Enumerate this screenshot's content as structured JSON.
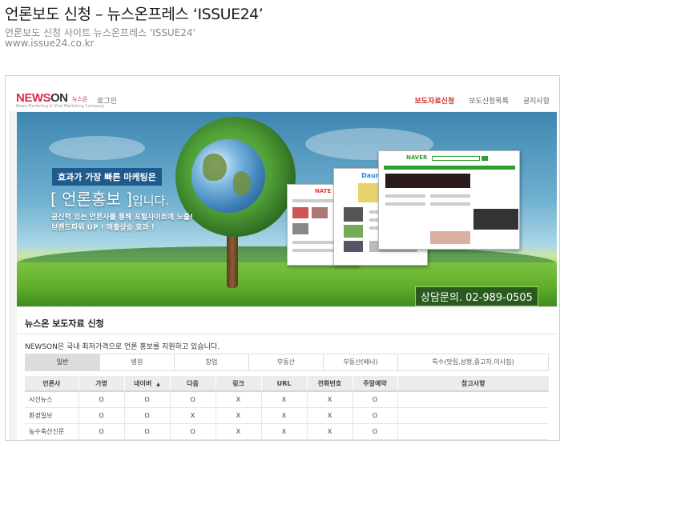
{
  "page": {
    "title": "언론보도 신청 – 뉴스온프레스 ‘ISSUE24’",
    "subtitle": "언론보도 신청 사이트 뉴스온프레스 'ISSUE24'",
    "url": "www.issue24.co.kr"
  },
  "site": {
    "logo_main_red": "NEWS",
    "logo_main_gray": "ON",
    "logo_sub": "뉴스온",
    "logo_tagline": "News Marketing & Viral Marketing Company",
    "login": "로그인",
    "nav": [
      "보도자료신청",
      "보도신청목록",
      "공지사항"
    ],
    "nav_active_index": 0
  },
  "hero": {
    "badge": "효과가 가장 빠른 마케팅은",
    "headline_bracket": "[ 언론홍보 ]",
    "headline_suffix": "입니다.",
    "line1": "공신력 있는 언론사를 통해 포털사이트에 노출!",
    "line2": "브랜드파워 UP ! 매출상승 효과 !",
    "phone": "상담문의. 02-989-0505",
    "mock_logos": [
      "NATE",
      "Daum",
      "NAVER"
    ]
  },
  "section": {
    "title": "뉴스온 보도자료 신청",
    "description": "NEWSON은 국내 최저가격으로 언론 홍보를 지원하고 있습니다.",
    "tabs": [
      "일반",
      "병원",
      "창업",
      "부동산",
      "부동산(배너)",
      "특수(맛집,성형,중고차,이사짐)"
    ],
    "active_tab": 0
  },
  "table": {
    "headers": [
      "언론사",
      "가명",
      "네이버",
      "다음",
      "링크",
      "URL",
      "전화번호",
      "주말예약",
      "참고사항"
    ],
    "sort_icon": "sort-up-icon",
    "rows": [
      [
        "시선뉴스",
        "O",
        "O",
        "O",
        "X",
        "X",
        "X",
        "O",
        ""
      ],
      [
        "환경일보",
        "O",
        "O",
        "X",
        "X",
        "X",
        "X",
        "O",
        ""
      ],
      [
        "농수축산신문",
        "O",
        "O",
        "O",
        "X",
        "X",
        "X",
        "O",
        ""
      ]
    ]
  },
  "colors": {
    "accent_red": "#e02a4a",
    "nav_active": "#d32f2f",
    "badge_blue": "#1f5a8c"
  }
}
